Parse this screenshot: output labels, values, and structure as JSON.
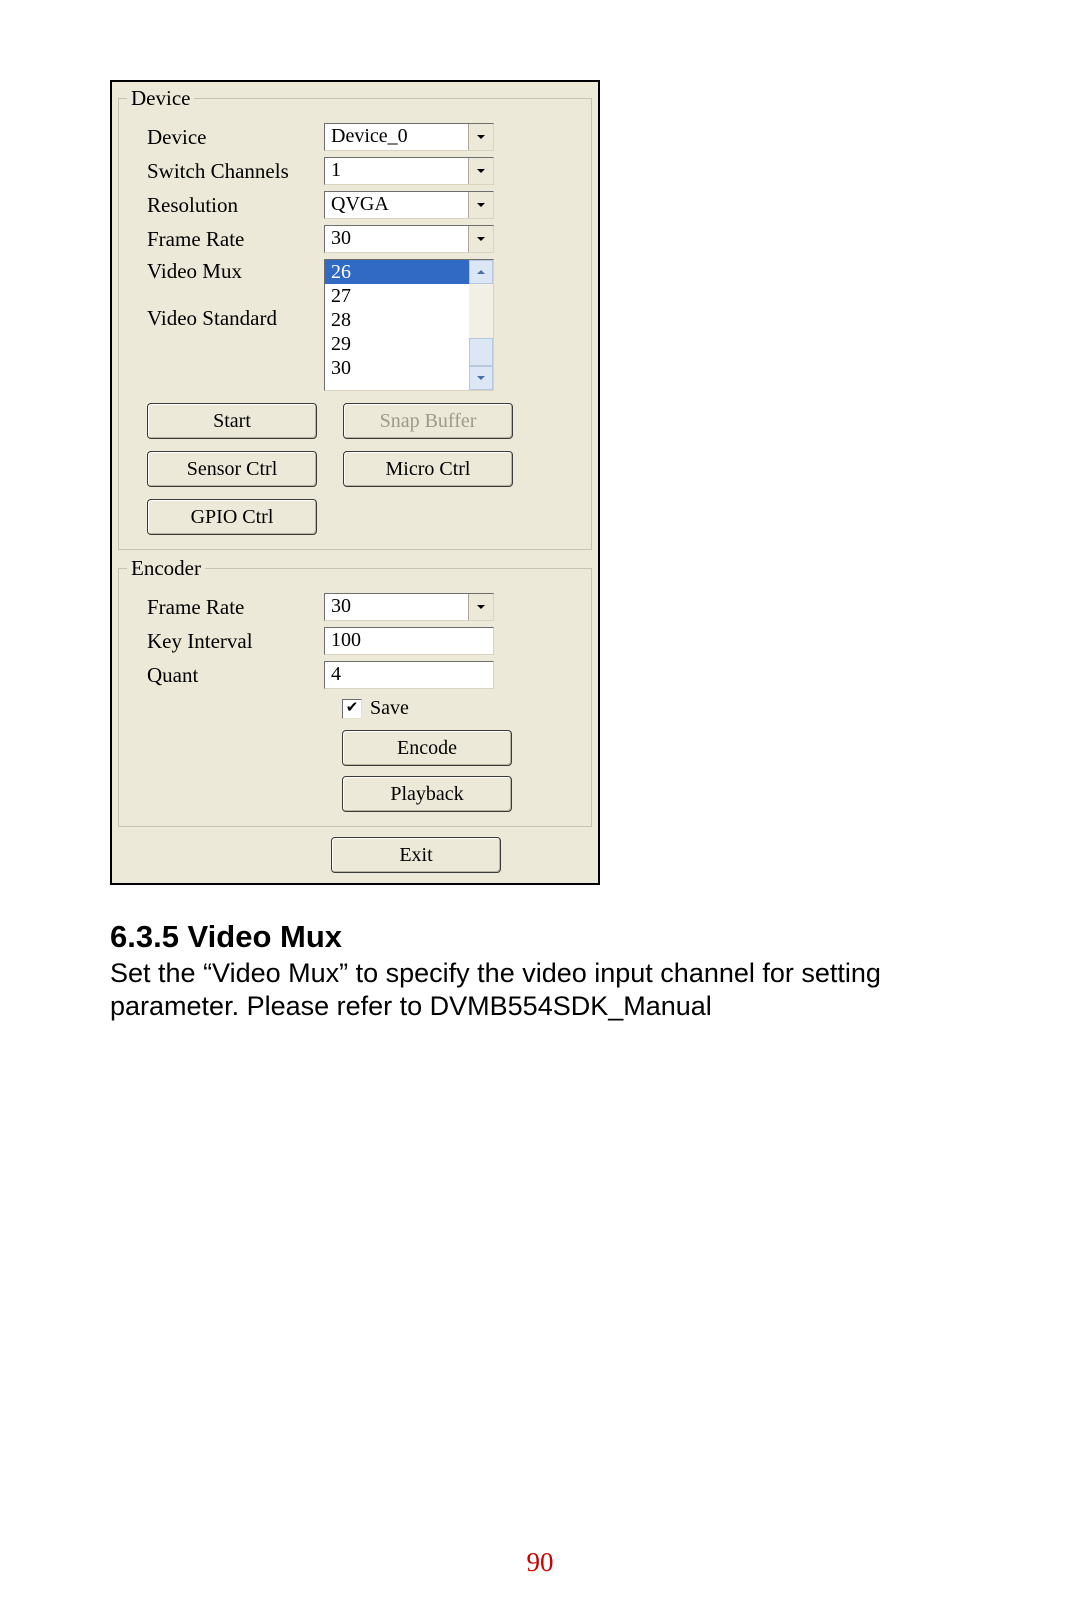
{
  "device": {
    "legend": "Device",
    "rows": {
      "device": {
        "label": "Device",
        "value": "Device_0"
      },
      "switch_channels": {
        "label": "Switch Channels",
        "value": "1"
      },
      "resolution": {
        "label": "Resolution",
        "value": "QVGA"
      },
      "frame_rate": {
        "label": "Frame Rate",
        "value": "30"
      },
      "video_mux": {
        "label": "Video Mux"
      },
      "video_standard": {
        "label": "Video Standard"
      }
    },
    "listbox": {
      "selected": "26",
      "items": [
        "26",
        "27",
        "28",
        "29",
        "30"
      ]
    },
    "buttons": {
      "start": "Start",
      "snap_buffer": "Snap Buffer",
      "sensor_ctrl": "Sensor Ctrl",
      "micro_ctrl": "Micro Ctrl",
      "gpio_ctrl": "GPIO Ctrl"
    }
  },
  "encoder": {
    "legend": "Encoder",
    "rows": {
      "frame_rate": {
        "label": "Frame Rate",
        "value": "30"
      },
      "key_interval": {
        "label": "Key Interval",
        "value": "100"
      },
      "quant": {
        "label": "Quant",
        "value": "4"
      }
    },
    "save_label": "Save",
    "save_checked": "✔",
    "buttons": {
      "encode": "Encode",
      "playback": "Playback"
    }
  },
  "exit_label": "Exit",
  "doc": {
    "heading": "6.3.5 Video Mux",
    "body1": "Set the “Video Mux” to specify the video input channel for setting",
    "body2": "parameter. Please refer to DVMB554SDK_Manual",
    "page_number": "90"
  }
}
